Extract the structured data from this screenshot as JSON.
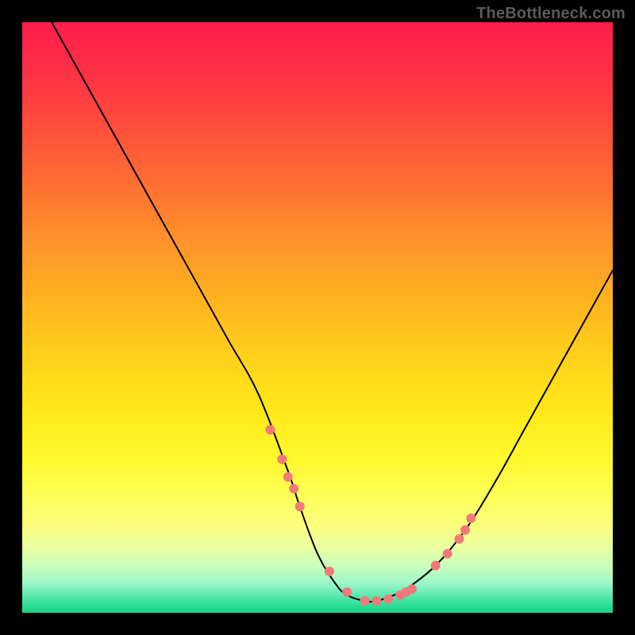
{
  "watermark": {
    "text": "TheBottleneck.com"
  },
  "chart_data": {
    "type": "line",
    "title": "",
    "xlabel": "",
    "ylabel": "",
    "xlim": [
      0,
      100
    ],
    "ylim": [
      0,
      100
    ],
    "grid": false,
    "legend": false,
    "series": [
      {
        "name": "bottleneck-curve",
        "x": [
          5,
          10,
          15,
          20,
          25,
          30,
          35,
          40,
          45,
          47,
          50,
          53,
          55,
          58,
          60,
          63,
          65,
          70,
          75,
          80,
          85,
          90,
          95,
          100
        ],
        "y": [
          100,
          91,
          82,
          73,
          64,
          55,
          46,
          37,
          24,
          18,
          10,
          5,
          3,
          2,
          2,
          3,
          4,
          8,
          14,
          22,
          31,
          40,
          49,
          58
        ]
      }
    ],
    "markers": {
      "name": "highlight-dots",
      "x": [
        42,
        44,
        45,
        46,
        47,
        52,
        55,
        58,
        60,
        62,
        64,
        65,
        66,
        70,
        72,
        74,
        75,
        76
      ],
      "y": [
        31,
        26,
        23,
        21,
        18,
        7,
        3.5,
        2,
        2,
        2.3,
        3,
        3.5,
        4,
        8,
        10,
        12.5,
        14,
        16
      ]
    },
    "background_gradient": {
      "direction": "vertical",
      "stops": [
        {
          "pos": 0,
          "color": "#ff1e4c"
        },
        {
          "pos": 50,
          "color": "#ffd41a"
        },
        {
          "pos": 85,
          "color": "#fbff7a"
        },
        {
          "pos": 100,
          "color": "#1dd38a"
        }
      ]
    }
  }
}
